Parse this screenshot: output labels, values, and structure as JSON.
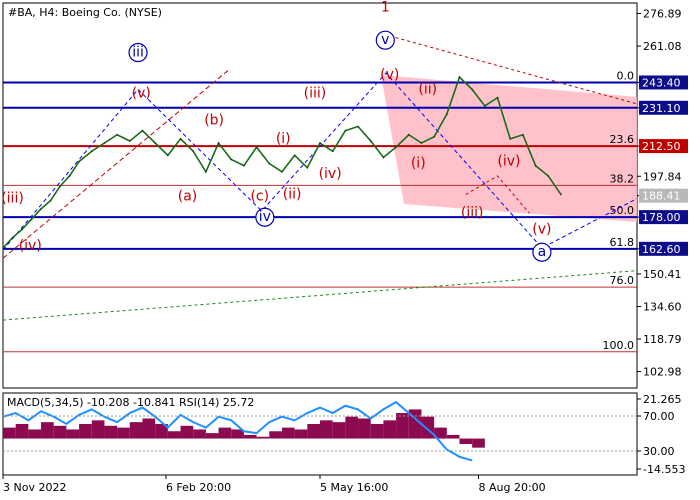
{
  "chart_data": [
    {
      "type": "line",
      "title": "#BA, H4:  Boeing Co. (NYSE)",
      "ylim": [
        95.0,
        282.0
      ],
      "xlim": [
        0,
        100
      ],
      "x_ticks": [
        {
          "x": 0,
          "label": "3 Nov 2022"
        },
        {
          "x": 25.7,
          "label": "6 Feb 20:00"
        },
        {
          "x": 50.0,
          "label": "5 May 16:00"
        },
        {
          "x": 75.0,
          "label": "8 Aug 20:00"
        }
      ],
      "y_ticks": [
        276.89,
        261.08,
        243.4,
        231.1,
        212.5,
        197.84,
        188.41,
        178.0,
        162.6,
        150.41,
        134.6,
        118.79,
        102.98
      ],
      "price_badges": [
        {
          "label": "243.40",
          "value": 243.4,
          "color": "#0d0d8c"
        },
        {
          "label": "231.10",
          "value": 231.1,
          "color": "#0d0d8c"
        },
        {
          "label": "212.50",
          "value": 212.5,
          "color": "#c00000"
        },
        {
          "label": "188.41",
          "value": 188.41,
          "color": "#b8b8b8"
        },
        {
          "label": "178.00",
          "value": 178.0,
          "color": "#0d0d8c"
        },
        {
          "label": "162.60",
          "value": 162.6,
          "color": "#0d0d8c"
        }
      ],
      "horizontal_levels": [
        {
          "value": 243.4,
          "color": "#0000b0",
          "width": 2
        },
        {
          "value": 231.1,
          "color": "#0000b0",
          "width": 2
        },
        {
          "value": 212.5,
          "color": "#c00000",
          "width": 2
        },
        {
          "value": 178.0,
          "color": "#0000b0",
          "width": 2
        },
        {
          "value": 162.6,
          "color": "#0000b0",
          "width": 2
        }
      ],
      "fib_levels": [
        {
          "label": "0.0",
          "value": 243.4
        },
        {
          "label": "23.6",
          "value": 212.5
        },
        {
          "label": "38.2",
          "value": 193.4
        },
        {
          "label": "50.0",
          "value": 178.0
        },
        {
          "label": "61.8",
          "value": 162.6
        },
        {
          "label": "76.0",
          "value": 144.0
        },
        {
          "label": "100.0",
          "value": 112.6
        }
      ],
      "price_series": {
        "x": [
          0,
          1.5,
          3,
          4.5,
          6,
          7.5,
          9,
          10.5,
          12,
          14,
          16,
          18,
          20,
          22,
          24,
          26,
          28,
          30,
          32,
          34,
          36,
          38,
          40,
          42,
          44,
          46,
          48,
          50,
          52,
          54,
          56,
          58,
          60,
          62,
          64,
          66,
          68,
          70,
          72,
          74,
          76,
          78,
          80,
          82,
          84,
          86,
          88
        ],
        "y": [
          163,
          168,
          172,
          177,
          182,
          186,
          193,
          198,
          205,
          210,
          214,
          218,
          215,
          220,
          214,
          208,
          216,
          210,
          200,
          214,
          206,
          203,
          212,
          204,
          200,
          208,
          202,
          214,
          210,
          220,
          222,
          215,
          207,
          212,
          218,
          214,
          217,
          228,
          246,
          240,
          232,
          236,
          216,
          218,
          203,
          198,
          189
        ]
      },
      "wave_labels": [
        {
          "text": "(iii)",
          "x": 1.5,
          "y": 185,
          "color": "#c00000",
          "circled": false
        },
        {
          "text": "(iv)",
          "x": 4.3,
          "y": 162,
          "color": "#c00000",
          "circled": false
        },
        {
          "text": "iii",
          "x": 21.3,
          "y": 256,
          "color": "#0000b0",
          "circled": true
        },
        {
          "text": "(v)",
          "x": 21.8,
          "y": 236,
          "color": "#c00000",
          "circled": false
        },
        {
          "text": "(b)",
          "x": 33.3,
          "y": 223,
          "color": "#c00000",
          "circled": false
        },
        {
          "text": "(a)",
          "x": 29.1,
          "y": 186,
          "color": "#c00000",
          "circled": false
        },
        {
          "text": "(c)",
          "x": 40.5,
          "y": 186,
          "color": "#c00000",
          "circled": false
        },
        {
          "text": "iv",
          "x": 41.3,
          "y": 176,
          "color": "#0000b0",
          "circled": true
        },
        {
          "text": "(i)",
          "x": 44.2,
          "y": 214,
          "color": "#c00000",
          "circled": false
        },
        {
          "text": "(ii)",
          "x": 45.6,
          "y": 187,
          "color": "#c00000",
          "circled": false
        },
        {
          "text": "(iii)",
          "x": 49.2,
          "y": 236,
          "color": "#c00000",
          "circled": false
        },
        {
          "text": "(iv)",
          "x": 51.6,
          "y": 197,
          "color": "#c00000",
          "circled": false
        },
        {
          "text": "1",
          "x": 60.3,
          "y": 278,
          "color": "#c00000",
          "circled": false
        },
        {
          "text": "v",
          "x": 60.3,
          "y": 262,
          "color": "#0000b0",
          "circled": true
        },
        {
          "text": "(v)",
          "x": 61.0,
          "y": 245,
          "color": "#c00000",
          "circled": false
        },
        {
          "text": "(ii)",
          "x": 67.0,
          "y": 238,
          "color": "#c00000",
          "circled": false
        },
        {
          "text": "(i)",
          "x": 65.5,
          "y": 202,
          "color": "#c00000",
          "circled": false
        },
        {
          "text": "(iii)",
          "x": 74.0,
          "y": 178,
          "color": "#c00000",
          "circled": false
        },
        {
          "text": "(iv)",
          "x": 79.8,
          "y": 203,
          "color": "#c00000",
          "circled": false
        },
        {
          "text": "(v)",
          "x": 85.0,
          "y": 170,
          "color": "#c00000",
          "circled": false
        },
        {
          "text": "a",
          "x": 85.0,
          "y": 159,
          "color": "#0000b0",
          "circled": true
        }
      ]
    },
    {
      "type": "area",
      "title": "MACD(5,34,5) -10.208 -10.841 RSI(14) 25.72",
      "ylim": [
        -20,
        25
      ],
      "y_ticks": [
        21.265,
        70.0,
        30.0,
        -14.553
      ],
      "histogram": {
        "x": [
          0,
          2,
          4,
          6,
          8,
          10,
          12,
          14,
          16,
          18,
          20,
          22,
          24,
          26,
          28,
          30,
          32,
          34,
          36,
          38,
          40,
          42,
          44,
          46,
          48,
          50,
          52,
          54,
          56,
          58,
          60,
          62,
          64,
          66,
          68,
          70,
          72,
          74
        ],
        "y": [
          6,
          8,
          5,
          9,
          7,
          5,
          8,
          10,
          7,
          6,
          9,
          11,
          8,
          4,
          7,
          5,
          3,
          6,
          5,
          2,
          1,
          4,
          6,
          5,
          8,
          10,
          9,
          12,
          11,
          8,
          10,
          14,
          16,
          12,
          6,
          2,
          -3,
          -5
        ]
      },
      "rsi": {
        "x": [
          0,
          2,
          4,
          6,
          8,
          10,
          12,
          14,
          16,
          18,
          20,
          22,
          24,
          26,
          28,
          30,
          32,
          34,
          36,
          38,
          40,
          42,
          44,
          46,
          48,
          50,
          52,
          54,
          56,
          58,
          60,
          62,
          64,
          66,
          68,
          70,
          72,
          74
        ],
        "y": [
          12,
          14,
          10,
          15,
          12,
          8,
          13,
          16,
          12,
          9,
          14,
          17,
          12,
          6,
          13,
          9,
          6,
          12,
          10,
          4,
          3,
          9,
          12,
          10,
          14,
          17,
          14,
          18,
          16,
          11,
          16,
          20,
          14,
          8,
          2,
          -6,
          -10,
          -12
        ]
      }
    }
  ]
}
